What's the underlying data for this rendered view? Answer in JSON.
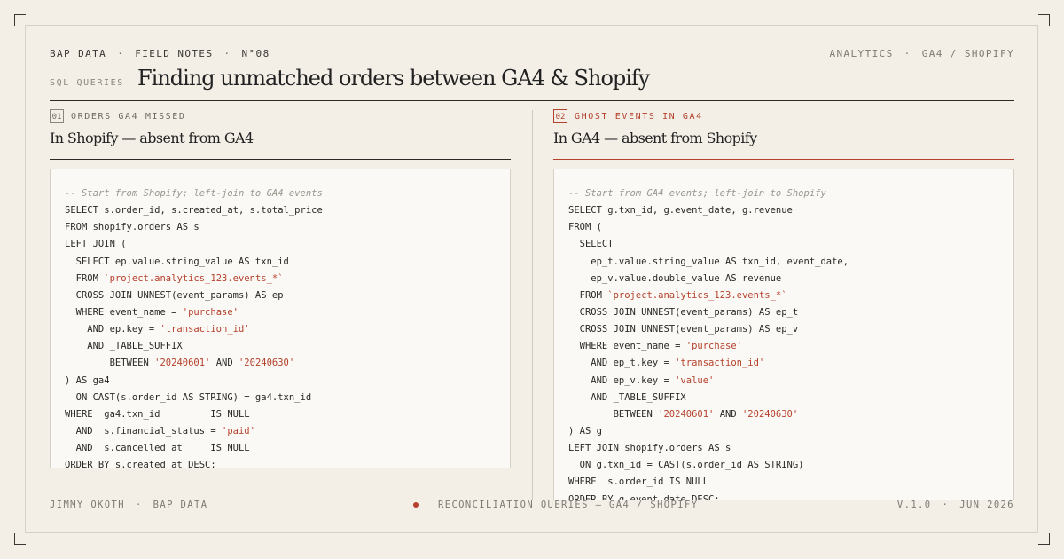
{
  "header": {
    "kicker": [
      "BAP DATA",
      "FIELD NOTES",
      "N°08"
    ],
    "separator": "·",
    "topright": [
      "ANALYTICS",
      "GA4 / SHOPIFY"
    ],
    "section_label": "SQL QUERIES",
    "title": "Finding unmatched orders between GA4 & Shopify"
  },
  "panels": [
    {
      "number": "01",
      "label": "ORDERS GA4 MISSED",
      "subtitle": "In Shopify — absent from GA4",
      "accent": "#2b2926",
      "code": [
        "-- Start from Shopify; left-join to GA4 events",
        "SELECT s.order_id, s.created_at, s.total_price",
        "FROM shopify.orders AS s",
        "LEFT JOIN (",
        "  SELECT ep.value.string_value AS txn_id",
        "  FROM `project.analytics_123.events_*`",
        "  CROSS JOIN UNNEST(event_params) AS ep",
        "  WHERE event_name = 'purchase'",
        "    AND ep.key = 'transaction_id'",
        "    AND _TABLE_SUFFIX",
        "        BETWEEN '20240601' AND '20240630'",
        ") AS ga4",
        "  ON CAST(s.order_id AS STRING) = ga4.txn_id",
        "WHERE  ga4.txn_id         IS NULL",
        "  AND  s.financial_status = 'paid'",
        "  AND  s.cancelled_at     IS NULL",
        "ORDER BY s.created_at DESC;"
      ]
    },
    {
      "number": "02",
      "label": "GHOST EVENTS IN GA4",
      "subtitle": "In GA4 — absent from Shopify",
      "accent": "#b5402c",
      "code": [
        "-- Start from GA4 events; left-join to Shopify",
        "SELECT g.txn_id, g.event_date, g.revenue",
        "FROM (",
        "  SELECT",
        "    ep_t.value.string_value AS txn_id, event_date,",
        "    ep_v.value.double_value AS revenue",
        "  FROM `project.analytics_123.events_*`",
        "  CROSS JOIN UNNEST(event_params) AS ep_t",
        "  CROSS JOIN UNNEST(event_params) AS ep_v",
        "  WHERE event_name = 'purchase'",
        "    AND ep_t.key = 'transaction_id'",
        "    AND ep_v.key = 'value'",
        "    AND _TABLE_SUFFIX",
        "        BETWEEN '20240601' AND '20240630'",
        ") AS g",
        "LEFT JOIN shopify.orders AS s",
        "  ON g.txn_id = CAST(s.order_id AS STRING)",
        "WHERE  s.order_id IS NULL",
        "ORDER BY g.event_date DESC;"
      ]
    }
  ],
  "footer": {
    "left": [
      "JIMMY OKOTH",
      "BAP DATA"
    ],
    "center": "RECONCILIATION QUERIES — GA4 / SHOPIFY",
    "right": [
      "V.1.0",
      "JUN 2026"
    ]
  }
}
